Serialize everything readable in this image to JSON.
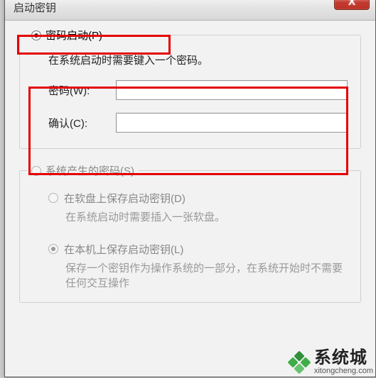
{
  "window": {
    "title": "启动密钥",
    "close_label": "X"
  },
  "group_password": {
    "legend": "密码启动(P)",
    "selected": true,
    "description": "在系统启动时需要键入一个密码。",
    "password_label": "密码(W):",
    "confirm_label": "确认(C):",
    "password_value": "",
    "confirm_value": ""
  },
  "group_system": {
    "legend": "系统产生的密码(S)",
    "selected": false,
    "opt_floppy": {
      "label": "在软盘上保存启动密钥(D)",
      "selected": false,
      "desc": "在系统启动时需要插入一张软盘。"
    },
    "opt_local": {
      "label": "在本机上保存启动密钥(L)",
      "selected": true,
      "desc": "保存一个密钥作为操作系统的一部分，在系统开始时不需要任何交互操作"
    }
  },
  "watermark": {
    "brand": "系统城",
    "url": "xitongcheng.com"
  }
}
